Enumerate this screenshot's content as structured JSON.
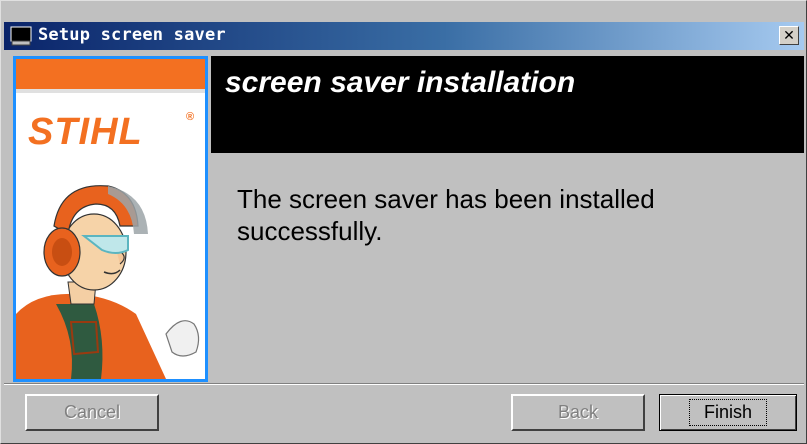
{
  "window": {
    "title": "Setup screen saver",
    "app_icon": "computer-icon",
    "close_glyph": "✕",
    "close_icon": "close-icon"
  },
  "side_panel": {
    "logo_text": "STIHL",
    "logo_mark": "®",
    "brand_color": "#f37021",
    "border_color": "#1e90ff",
    "mascot": "stihl-mascot-image"
  },
  "header": {
    "title": "screen saver installation"
  },
  "content": {
    "message": "The screen saver has been installed successfully."
  },
  "buttons": {
    "cancel_label": "Cancel",
    "back_label": "Back",
    "finish_label": "Finish"
  }
}
